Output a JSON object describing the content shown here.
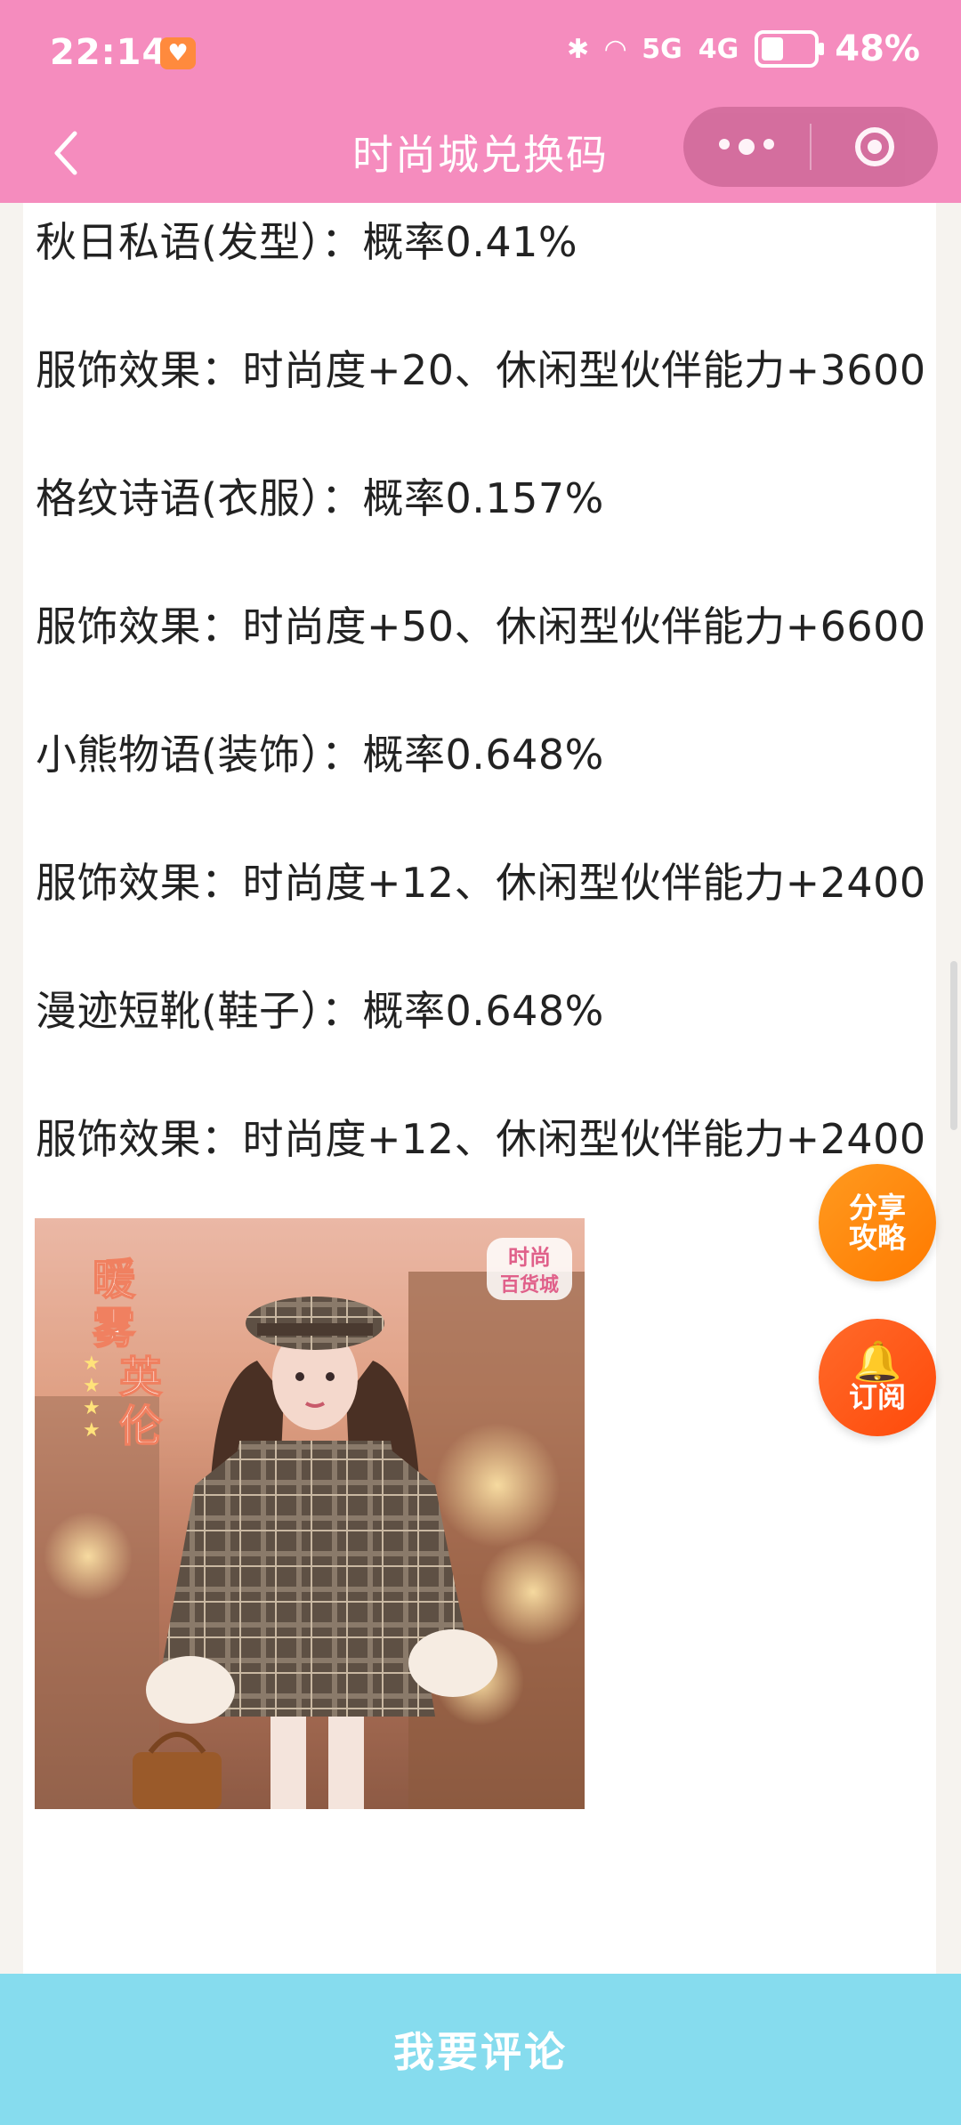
{
  "status_bar": {
    "time": "22:14",
    "signal_5g": "5G",
    "signal_4g": "4G",
    "battery": "48%"
  },
  "nav": {
    "title": "时尚城兑换码"
  },
  "content": {
    "lines": [
      "秋日私语(发型）：概率0.41%",
      "服饰效果：时尚度+20、休闲型伙伴能力+3600",
      "格纹诗语(衣服）：概率0.157%",
      "服饰效果：时尚度+50、休闲型伙伴能力+6600",
      "小熊物语(装饰）：概率0.648%",
      "服饰效果：时尚度+12、休闲型伙伴能力+2400",
      "漫迹短靴(鞋子）：概率0.648%",
      "服饰效果：时尚度+12、休闲型伙伴能力+2400"
    ],
    "image": {
      "title_text": "暖雾英伦",
      "logo_text": "时尚百货城"
    }
  },
  "fab": {
    "share_line1": "分享",
    "share_line2": "攻略",
    "subscribe": "订阅"
  },
  "bottom_bar": {
    "comment_label": "我要评论"
  },
  "colors": {
    "header": "#f58cbe",
    "bottom_bar": "#86dcee",
    "fab_share": "#ff8a0a",
    "fab_subscribe": "#ff560f"
  }
}
